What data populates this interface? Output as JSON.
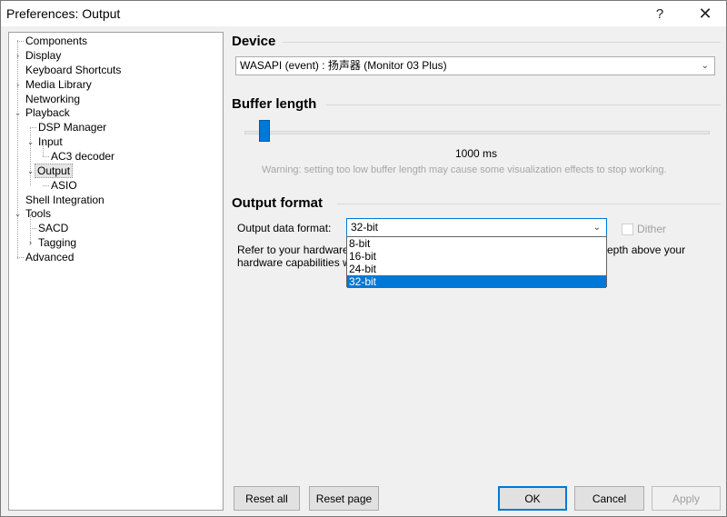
{
  "window": {
    "title": "Preferences: Output",
    "help_label": "?",
    "close_label": "✕"
  },
  "tree": {
    "items": [
      {
        "label": "Components"
      },
      {
        "label": "Display"
      },
      {
        "label": "Keyboard Shortcuts"
      },
      {
        "label": "Media Library"
      },
      {
        "label": "Networking"
      },
      {
        "label": "Playback"
      },
      {
        "label": "DSP Manager"
      },
      {
        "label": "Input"
      },
      {
        "label": "AC3 decoder"
      },
      {
        "label": "Output"
      },
      {
        "label": "ASIO"
      },
      {
        "label": "Shell Integration"
      },
      {
        "label": "Tools"
      },
      {
        "label": "SACD"
      },
      {
        "label": "Tagging"
      },
      {
        "label": "Advanced"
      }
    ],
    "selected": "Output"
  },
  "device": {
    "heading": "Device",
    "selected": "WASAPI (event) : 扬声器 (Monitor 03 Plus)"
  },
  "buffer": {
    "heading": "Buffer length",
    "value_label": "1000 ms",
    "warning": "Warning: setting too low buffer length may cause some visualization effects to stop working."
  },
  "output_format": {
    "heading": "Output format",
    "data_format_label": "Output data format:",
    "selected": "32-bit",
    "options": [
      "8-bit",
      "16-bit",
      "24-bit",
      "32-bit"
    ],
    "dither_label": "Dither",
    "dither_checked": false,
    "help_line1_left": "Refer to your hardware",
    "help_line1_right": "epth above your",
    "help_line2_left": "hardware capabilities w"
  },
  "buttons": {
    "reset_all": "Reset all",
    "reset_page": "Reset page",
    "ok": "OK",
    "cancel": "Cancel",
    "apply": "Apply"
  }
}
